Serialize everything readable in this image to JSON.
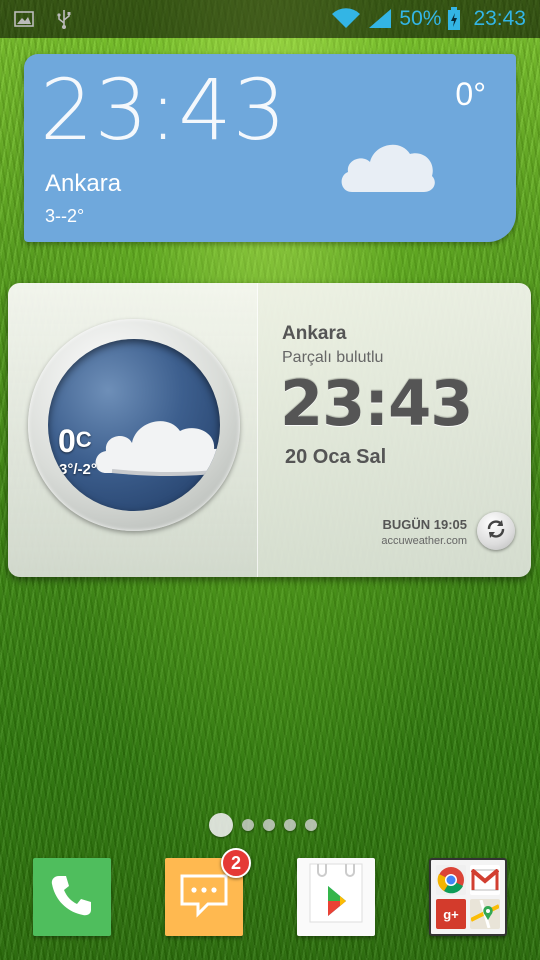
{
  "status_bar": {
    "battery": "50%",
    "time": "23:43",
    "icons": [
      "image-icon",
      "usb-icon",
      "wifi-icon",
      "signal-icon",
      "battery-charging-icon"
    ],
    "accent_color": "#33b5e5"
  },
  "clock_widget": {
    "time": "23:43",
    "temperature": "0°",
    "city": "Ankara",
    "range": "3--2°",
    "icon": "cloud-icon",
    "background_color": "#6fa8dc"
  },
  "weather_widget": {
    "temperature": "0",
    "temperature_unit": "C",
    "range": "3°/-2°",
    "city": "Ankara",
    "condition": "Parçalı bulutlu",
    "time": "23:43",
    "date": "20 Oca Sal",
    "updated": "BUGÜN 19:05",
    "source": "accuweather.com",
    "refresh_icon": "refresh-icon"
  },
  "home": {
    "pages": 5,
    "current_page": 1
  },
  "dock": {
    "apps": [
      {
        "name": "Phone",
        "icon": "phone-icon",
        "color": "#4fbe5d"
      },
      {
        "name": "Messaging",
        "icon": "message-icon",
        "color": "#ffb950",
        "badge": "2"
      },
      {
        "name": "Play Store",
        "icon": "play-store-icon"
      },
      {
        "name": "Google",
        "icon": "google-folder-icon",
        "items": [
          "Chrome",
          "Gmail",
          "Google+",
          "Maps"
        ],
        "gplus_label": "g+"
      }
    ]
  }
}
